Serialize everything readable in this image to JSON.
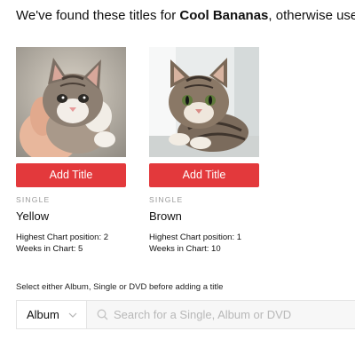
{
  "header": {
    "prefix": "We've found these titles for ",
    "artist": "Cool Bananas",
    "suffix": ", otherwise use Search"
  },
  "results": [
    {
      "image": "kitten-photo",
      "button_label": "Add Title",
      "type": "SINGLE",
      "title": "Yellow",
      "chart_position": "Highest Chart position: 2",
      "weeks": "Weeks in Chart: 5"
    },
    {
      "image": "kitten-photo",
      "button_label": "Add Title",
      "type": "SINGLE",
      "title": "Brown",
      "chart_position": "Highest Chart position: 1",
      "weeks": "Weeks in Chart: 10"
    }
  ],
  "search": {
    "instruction": "Select either Album, Single or DVD before adding a title",
    "type_selected": "Album",
    "placeholder": "Search for a Single, Album or DVD",
    "value": ""
  },
  "colors": {
    "accent": "#e3393c",
    "muted": "#9a9a9a"
  }
}
